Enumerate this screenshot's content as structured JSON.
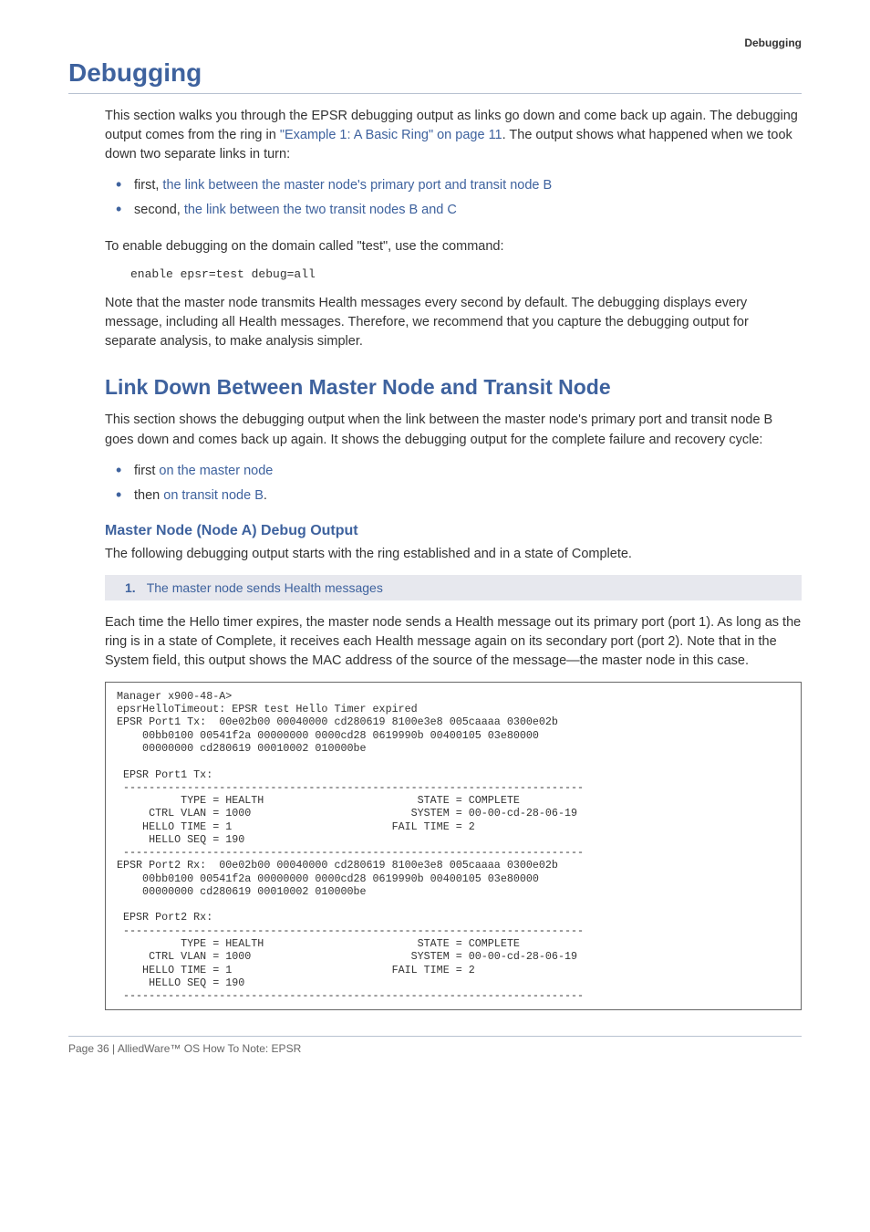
{
  "header": {
    "section": "Debugging"
  },
  "title": "Debugging",
  "intro1_prefix": "This section walks you through the EPSR debugging output as links go down and come back up again. The debugging output comes from the ring in ",
  "intro1_link": "\"Example 1: A Basic Ring\" on page 11",
  "intro1_suffix": ". The output shows what happened when we took down two separate links in turn:",
  "bullets1": [
    {
      "prefix": "first, ",
      "link": "the link between the master node's primary port and transit node B"
    },
    {
      "prefix": "second, ",
      "link": "the link between the two transit nodes B and C"
    }
  ],
  "enable_para": "To enable debugging on the domain called \"test\", use the command:",
  "enable_cmd": "enable epsr=test debug=all",
  "note_para": "Note that the master node transmits Health messages every second by default. The debugging displays every message, including all Health messages. Therefore, we recommend that you capture the debugging output for separate analysis, to make analysis simpler.",
  "h2": "Link Down Between Master Node and Transit Node",
  "h2_para": "This section shows the debugging output when the link between the master node's primary port and transit node B goes down and comes back up again. It shows the debugging output for the complete failure and recovery cycle:",
  "bullets2": [
    {
      "prefix": "first ",
      "link": "on the master node"
    },
    {
      "prefix": "then ",
      "link": "on transit node B",
      "suffix": "."
    }
  ],
  "h3": "Master Node (Node A) Debug Output",
  "h3_para": "The following debugging output starts with the ring established and in a state of Complete.",
  "step": {
    "num": "1.",
    "text": "The master node sends Health messages"
  },
  "step_para": "Each time the Hello timer expires, the master node sends a Health message out its primary port (port 1). As long as the ring is in a state of Complete, it receives each Health message again on its secondary port (port 2). Note that in the System field, this output shows the MAC address of the source of the message—the master node in this case.",
  "code": "Manager x900-48-A>\nepsrHelloTimeout: EPSR test Hello Timer expired\nEPSR Port1 Tx:  00e02b00 00040000 cd280619 8100e3e8 005caaaa 0300e02b\n    00bb0100 00541f2a 00000000 0000cd28 0619990b 00400105 03e80000\n    00000000 cd280619 00010002 010000be\n\n EPSR Port1 Tx:\n ------------------------------------------------------------------------\n          TYPE = HEALTH                        STATE = COMPLETE\n     CTRL VLAN = 1000                         SYSTEM = 00-00-cd-28-06-19\n    HELLO TIME = 1                         FAIL TIME = 2\n     HELLO SEQ = 190\n ------------------------------------------------------------------------\nEPSR Port2 Rx:  00e02b00 00040000 cd280619 8100e3e8 005caaaa 0300e02b\n    00bb0100 00541f2a 00000000 0000cd28 0619990b 00400105 03e80000\n    00000000 cd280619 00010002 010000be\n\n EPSR Port2 Rx:\n ------------------------------------------------------------------------\n          TYPE = HEALTH                        STATE = COMPLETE\n     CTRL VLAN = 1000                         SYSTEM = 00-00-cd-28-06-19\n    HELLO TIME = 1                         FAIL TIME = 2\n     HELLO SEQ = 190\n ------------------------------------------------------------------------",
  "footer": "Page 36 | AlliedWare™ OS How To Note: EPSR"
}
